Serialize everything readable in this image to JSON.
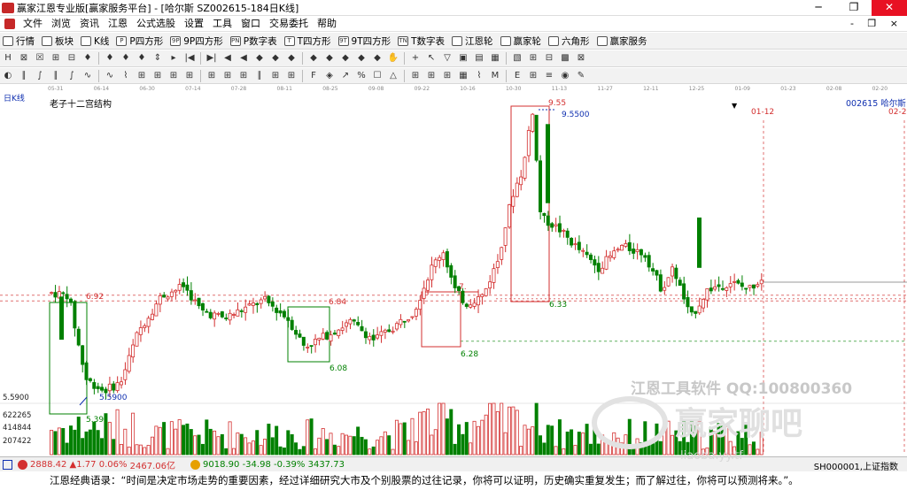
{
  "window": {
    "title": "赢家江恩专业版[赢家服务平台] - [哈尔斯  SZ002615-184日K线]",
    "controls": [
      "─",
      "❐",
      "✕"
    ]
  },
  "menu": {
    "items": [
      "文件",
      "浏览",
      "资讯",
      "江恩",
      "公式选股",
      "设置",
      "工具",
      "窗口",
      "交易委托",
      "帮助"
    ],
    "right": "-  ❐  ×"
  },
  "toolbar1": [
    "行情",
    "板块",
    "K线",
    "P四方形",
    "9P四方形",
    "P数字表",
    "T四方形",
    "9T四方形",
    "T数字表",
    "江恩轮",
    "赢家轮",
    "六角形",
    "赢家服务"
  ],
  "toolbar1_icon_text": [
    "",
    "",
    "",
    "P",
    "9P",
    "PN",
    "T",
    "9T",
    "TN",
    "",
    "",
    "",
    ""
  ],
  "toolbar2_icons": [
    "H",
    "⊠",
    "☒",
    "⊞",
    "⊟",
    "♦",
    "♦",
    "♦",
    "♦",
    "⇕",
    "▸",
    "|◀",
    "▶|",
    "◀",
    "◀",
    "◆",
    "◆",
    "◆",
    "◆",
    "◆",
    "◆",
    "◆",
    "◆",
    "✋",
    "+",
    "↖",
    "▽",
    "▣",
    "▤",
    "▦",
    "▧",
    "⊞",
    "⊟",
    "▩",
    "⊠"
  ],
  "toolbar3_icons": [
    "◐",
    "∥",
    "∫",
    "∥",
    "∫",
    "∿",
    "∿",
    "⌇",
    "⊞",
    "⊞",
    "⊞",
    "⊞",
    "⊞",
    "⊞",
    "⊞",
    "∥",
    "⊞",
    "⊞",
    "F",
    "◈",
    "↗",
    "%",
    "☐",
    "△",
    "⊞",
    "⊞",
    "⊞",
    "▦",
    "⌇",
    "M",
    "E",
    "⊞",
    "≡",
    "◉",
    "✎"
  ],
  "chart_header": {
    "period_button": "日K线",
    "structure_name": "老子十二宫结构",
    "stock": "002615  哈尔斯",
    "date_right": "01-12",
    "date_right2": "02-2"
  },
  "date_axis": [
    "05-31",
    "06-14",
    "06-30",
    "07-14",
    "07-28",
    "08-11",
    "08-25",
    "09-08",
    "09-22",
    "10-16",
    "10-30",
    "11-13",
    "11-27",
    "12-11",
    "12-25",
    "01-09",
    "01-23",
    "02-08",
    "02-20"
  ],
  "chart_data": {
    "type": "candlestick",
    "title": "老子十二宫结构",
    "price_labels": [
      {
        "text": "9.55",
        "color": "#d32f2f"
      },
      {
        "text": "9.5500",
        "color": "#1030b0"
      },
      {
        "text": "6.92",
        "color": "#d32f2f"
      },
      {
        "text": "6.84",
        "color": "#d32f2f"
      },
      {
        "text": "6.33",
        "color": "#008000"
      },
      {
        "text": "6.28",
        "color": "#008000"
      },
      {
        "text": "6.08",
        "color": "#008000"
      },
      {
        "text": "5.5900",
        "color": "#1030b0"
      },
      {
        "text": "5.39",
        "color": "#008000"
      },
      {
        "text": "7.",
        "color": "#d32f2f"
      }
    ],
    "y_axis_labels": [
      "5.5900",
      "622265",
      "414844",
      "207422"
    ],
    "candles_count": 184,
    "volume_axis_max": 622265
  },
  "watermarks": {
    "tool": "江恩工具软件  QQ:100800360",
    "site": "赢家聊吧",
    "url": "liaoba.yy.tf"
  },
  "status": {
    "sh": {
      "value": "2888.42",
      "change": "▲1.77",
      "pct": "0.06%",
      "amount": "2467.06亿"
    },
    "sz": {
      "value": "9018.90",
      "change": "-34.98",
      "pct": "-0.39%",
      "amount": "3437.73"
    },
    "right": "SH000001,上证指数"
  },
  "quote": "江恩经典语录：“时间是决定市场走势的重要因素，经过详细研究大市及个别股票的过往记录，你将可以证明，历史确实重复发生；而了解过往，你将可以预测将来。”。"
}
